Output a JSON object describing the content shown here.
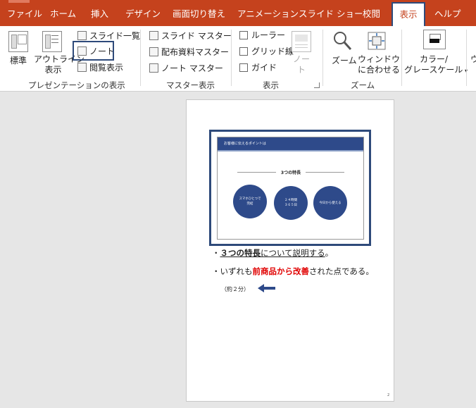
{
  "tabs": [
    {
      "label": "ファイル",
      "active": false
    },
    {
      "label": "ホーム",
      "active": false
    },
    {
      "label": "挿入",
      "active": false
    },
    {
      "label": "デザイン",
      "active": false
    },
    {
      "label": "画面切り替え",
      "active": false
    },
    {
      "label": "アニメーション",
      "active": false
    },
    {
      "label": "スライド ショー",
      "active": false
    },
    {
      "label": "校閲",
      "active": false
    },
    {
      "label": "表示",
      "active": true
    },
    {
      "label": "ヘルプ",
      "active": false
    }
  ],
  "ribbon": {
    "presentation_views": {
      "group_label": "プレゼンテーションの表示",
      "normal": "標準",
      "outline_line1": "アウトライン",
      "outline_line2": "表示",
      "slide_sorter": "スライド一覧",
      "notes": "ノート",
      "reading": "閲覧表示"
    },
    "master_views": {
      "group_label": "マスター表示",
      "slide_master": "スライド マスター",
      "handout_master": "配布資料マスター",
      "notes_master": "ノート マスター"
    },
    "show": {
      "group_label": "表示",
      "ruler": "ルーラー",
      "gridlines": "グリッド線",
      "guides": "ガイド",
      "notes_line1": "ノー",
      "notes_line2": "ト"
    },
    "zoom": {
      "group_label": "ズーム",
      "zoom": "ズーム",
      "fit_line1": "ウィンドウ",
      "fit_line2": "に合わせる"
    },
    "color": {
      "line1": "カラー/",
      "line2": "グレースケール"
    },
    "cut_label": "ウ"
  },
  "slide": {
    "header": "お客様に伝えるポイントは",
    "title": "3つの特長",
    "circles": [
      "スマホひとつで\n完結",
      "２４時間\n３６５日",
      "今日から使える"
    ]
  },
  "notes": {
    "line1_prefix": "・",
    "line1_bold": "３つの特長",
    "line1_rest": "について説明する",
    "line1_end": "。",
    "line2_prefix": "・いずれも",
    "line2_red": "前商品から改善",
    "line2_rest": "された点である。",
    "line3": "（約２分）"
  },
  "page_number": "2",
  "colors": {
    "accent": "#c5421d",
    "highlight": "#2e4a7a",
    "slide_blue": "#2e4a8a",
    "emphasis_red": "#e00000"
  }
}
